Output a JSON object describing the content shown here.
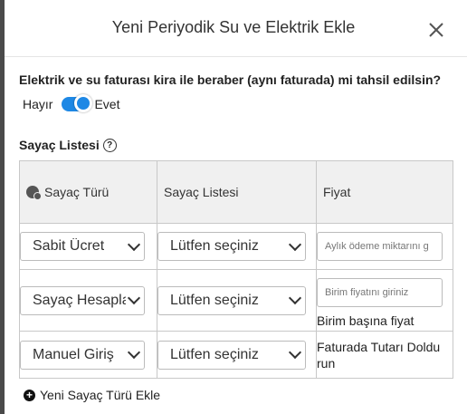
{
  "modal": {
    "title": "Yeni Periyodik Su ve Elektrik Ekle",
    "question": "Elektrik ve su faturası kira ile beraber (aynı faturada) mi tahsil edilsin?",
    "toggle": {
      "off_label": "Hayır",
      "on_label": "Evet",
      "state": "on"
    },
    "section_label": "Sayaç Listesi",
    "help_glyph": "?",
    "table": {
      "headers": [
        "Sayaç Türü",
        "Sayaç Listesi",
        "Fiyat"
      ],
      "rows": [
        {
          "type": "Sabit Ücret",
          "meter": "Lütfen seçiniz",
          "price_placeholder": "Aylık ödeme miktarını g",
          "price_note": ""
        },
        {
          "type": "Sayaç Hesapla",
          "meter": "Lütfen seçiniz",
          "price_placeholder": "Birim fiyatını giriniz",
          "price_note": "Birim başına fiyat"
        },
        {
          "type": "Manuel Giriş",
          "meter": "Lütfen seçiniz",
          "price_placeholder": "",
          "price_note": "Faturada Tutarı Doldurun"
        }
      ]
    },
    "add_button": "Yeni Sayaç Türü Ekle"
  },
  "colors": {
    "accent": "#1e88e5",
    "header_bg": "#f0f0f0",
    "border": "#c8c8c8"
  },
  "icons": {
    "close": "close-icon",
    "help": "help-icon",
    "type_header": "settings-cluster-icon",
    "add": "plus-circle-icon"
  }
}
